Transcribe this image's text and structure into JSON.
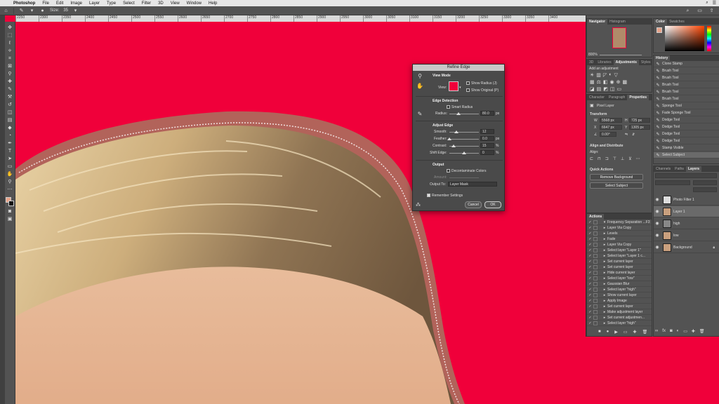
{
  "menubar": {
    "app_name": "Photoshop",
    "items": [
      "File",
      "Edit",
      "Image",
      "Layer",
      "Type",
      "Select",
      "Filter",
      "3D",
      "View",
      "Window",
      "Help"
    ]
  },
  "optionsbar": {
    "size_label": "Size:",
    "size_value": "35"
  },
  "ruler": {
    "ticks": [
      "2250",
      "2300",
      "2350",
      "2400",
      "2450",
      "2500",
      "2550",
      "2600",
      "2650",
      "2700",
      "2750",
      "2800",
      "2850",
      "2900",
      "2950",
      "3000",
      "3050",
      "3100",
      "3150",
      "3200",
      "3250",
      "3300",
      "3350",
      "3400"
    ]
  },
  "refine_edge": {
    "title": "Refine Edge",
    "view_mode": "View Mode",
    "view_label": "View:",
    "show_radius": "Show Radius (J)",
    "show_original": "Show Original (P)",
    "edge_detection": "Edge Detection",
    "smart_radius": "Smart Radius",
    "radius_label": "Radius:",
    "radius_value": "80.0",
    "radius_unit": "px",
    "adjust_edge": "Adjust Edge",
    "smooth_label": "Smooth:",
    "smooth_value": "12",
    "feather_label": "Feather:",
    "feather_value": "0.0",
    "feather_unit": "px",
    "contrast_label": "Contrast:",
    "contrast_value": "15",
    "contrast_unit": "%",
    "shift_label": "Shift Edge:",
    "shift_value": "0",
    "shift_unit": "%",
    "output": "Output",
    "decontaminate": "Decontaminate Colors",
    "amount_label": "Amount:",
    "output_to_label": "Output To:",
    "output_to_value": "Layer Mask",
    "remember": "Remember Settings",
    "cancel": "Cancel",
    "ok": "OK",
    "slider_levels": {
      "radius": 0.32,
      "smooth": 0.24,
      "feather": 0.0,
      "contrast": 0.15,
      "shift": 0.5
    }
  },
  "navigator": {
    "tabs": [
      "Navigator",
      "Histogram"
    ],
    "zoom": "800%"
  },
  "color_panel": {
    "tabs": [
      "Color",
      "Swatches"
    ]
  },
  "adjustments": {
    "tabs": [
      "3D",
      "Libraries",
      "Adjustments",
      "Styles"
    ],
    "hint": "Add an adjustment"
  },
  "properties": {
    "tabs": [
      "Character",
      "Paragraph",
      "Properties"
    ],
    "layer_type": "Pixel Layer",
    "transform": "Transform",
    "w": "5568 px",
    "h": "725 px",
    "x": "6647 px",
    "y": "1305 px",
    "angle": "0.00°",
    "align": "Align and Distribute",
    "align_label": "Align:",
    "quick_actions": "Quick Actions",
    "remove_bg": "Remove Background",
    "select_subject": "Select Subject"
  },
  "history": {
    "title": "History",
    "items": [
      "Clone Stamp",
      "Brush Tool",
      "Brush Tool",
      "Brush Tool",
      "Brush Tool",
      "Brush Tool",
      "Sponge Tool",
      "Fade Sponge Tool",
      "Dodge Tool",
      "Dodge Tool",
      "Dodge Tool",
      "Dodge Tool",
      "Stamp Visible",
      "Select Subject"
    ]
  },
  "layers": {
    "tabs": [
      "Channels",
      "Paths",
      "Layers"
    ],
    "items": [
      {
        "name": "Photo Filter 1",
        "type": "adjustment"
      },
      {
        "name": "Layer 1",
        "type": "pixel"
      },
      {
        "name": "high",
        "type": "pixel"
      },
      {
        "name": "low",
        "type": "pixel"
      },
      {
        "name": "Background",
        "type": "pixel"
      }
    ]
  },
  "actions": {
    "title": "Actions",
    "items": [
      "Frequency Separation ...F3",
      "Layer Via Copy",
      "Levels",
      "Fade",
      "Layer Via Copy",
      "Select layer \"Layer 1\"",
      "Select layer \"Layer 1 c...",
      "Set current layer",
      "Set current layer",
      "Hide current layer",
      "Select layer \"low\"",
      "Gaussian Blur",
      "Select layer \"high\"",
      "Show current layer",
      "Apply Image",
      "Set current layer",
      "Make adjustment layer",
      "Set current adjustmen...",
      "Select layer \"high\""
    ]
  },
  "colors": {
    "canvas_bg": "#f0003a",
    "ui_dark": "#535353",
    "fg_swatch": "#e8a48a"
  }
}
